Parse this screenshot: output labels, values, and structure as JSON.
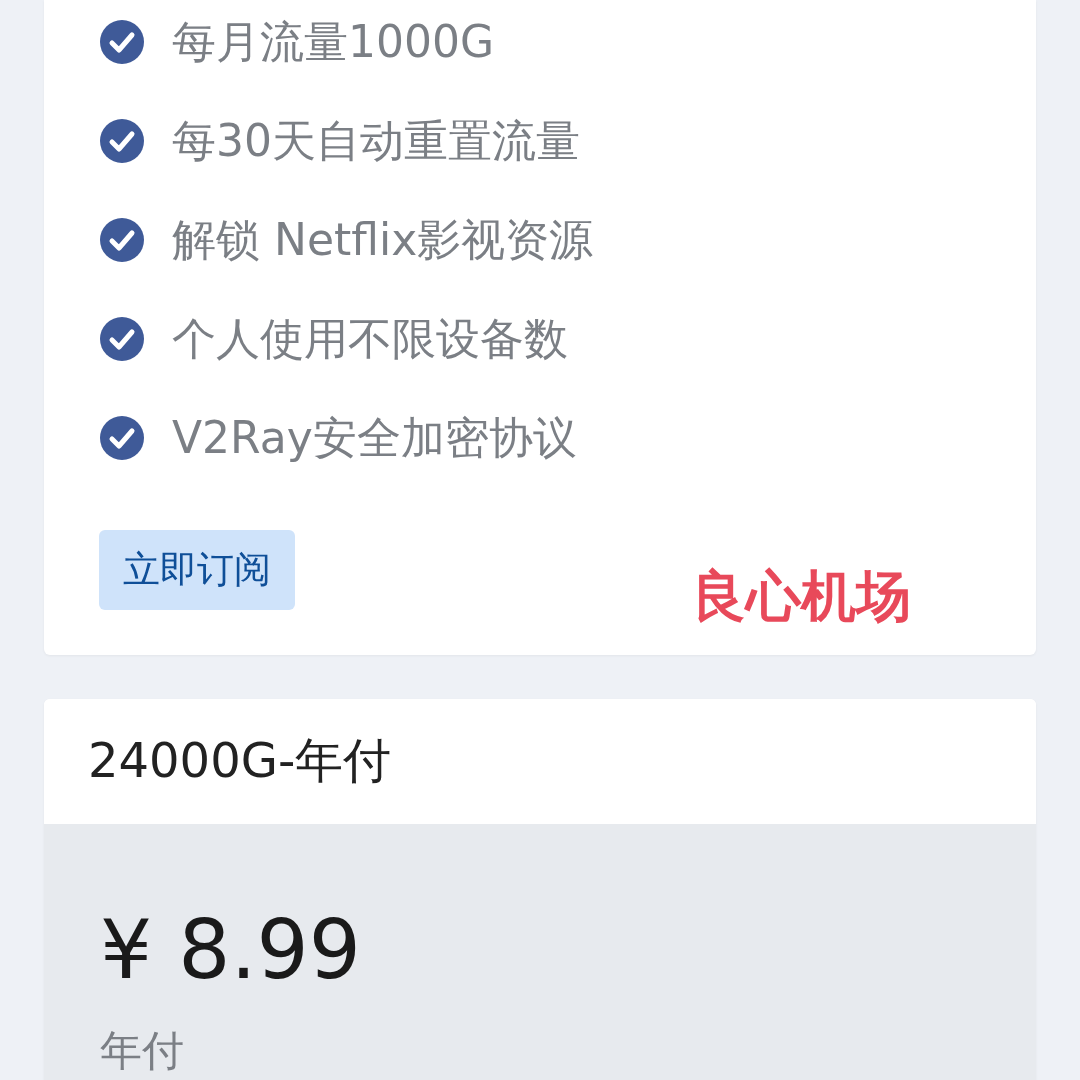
{
  "plans": [
    {
      "features": [
        "每月流量1000G",
        "每30天自动重置流量",
        "解锁 Netflix影视资源",
        "个人使用不限设备数",
        "V2Ray安全加密协议"
      ],
      "subscribe_button": "立即订阅",
      "annotation": "良心机场"
    },
    {
      "title": "24000G-年付",
      "price": "¥ 8.99",
      "period": "年付"
    }
  ]
}
